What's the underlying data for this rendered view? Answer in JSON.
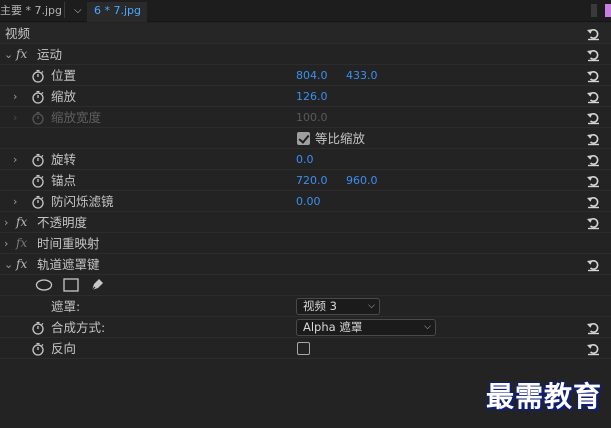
{
  "tabs": {
    "main": "主要 * 7.jpg",
    "active": "6 * 7.jpg"
  },
  "section_video": "视频",
  "motion": {
    "title": "运动",
    "position": {
      "label": "位置",
      "x": "804.0",
      "y": "433.0"
    },
    "scale": {
      "label": "缩放",
      "value": "126.0"
    },
    "scale_width": {
      "label": "缩放宽度",
      "value": "100.0"
    },
    "uniform_scale": {
      "label": "等比缩放",
      "checked": true
    },
    "rotation": {
      "label": "旋转",
      "value": "0.0"
    },
    "anchor": {
      "label": "锚点",
      "x": "720.0",
      "y": "960.0"
    },
    "anti_flicker": {
      "label": "防闪烁滤镜",
      "value": "0.00"
    }
  },
  "opacity": {
    "title": "不透明度"
  },
  "time_remap": {
    "title": "时间重映射"
  },
  "track_matte": {
    "title": "轨道遮罩键",
    "matte": {
      "label": "遮罩:",
      "value": "视频 3"
    },
    "composite": {
      "label": "合成方式:",
      "value": "Alpha 遮罩"
    },
    "reverse": {
      "label": "反向",
      "checked": false
    }
  },
  "watermark": "最需教育",
  "colors": {
    "value_blue": "#3b8ff0",
    "active_tab_blue": "#4aa8ff",
    "background": "#232323"
  },
  "icons": [
    "fx-icon",
    "stopwatch-icon",
    "reset-icon",
    "chevron-right-icon",
    "chevron-down-icon",
    "ellipse-mask-icon",
    "rectangle-mask-icon",
    "pen-mask-icon"
  ]
}
